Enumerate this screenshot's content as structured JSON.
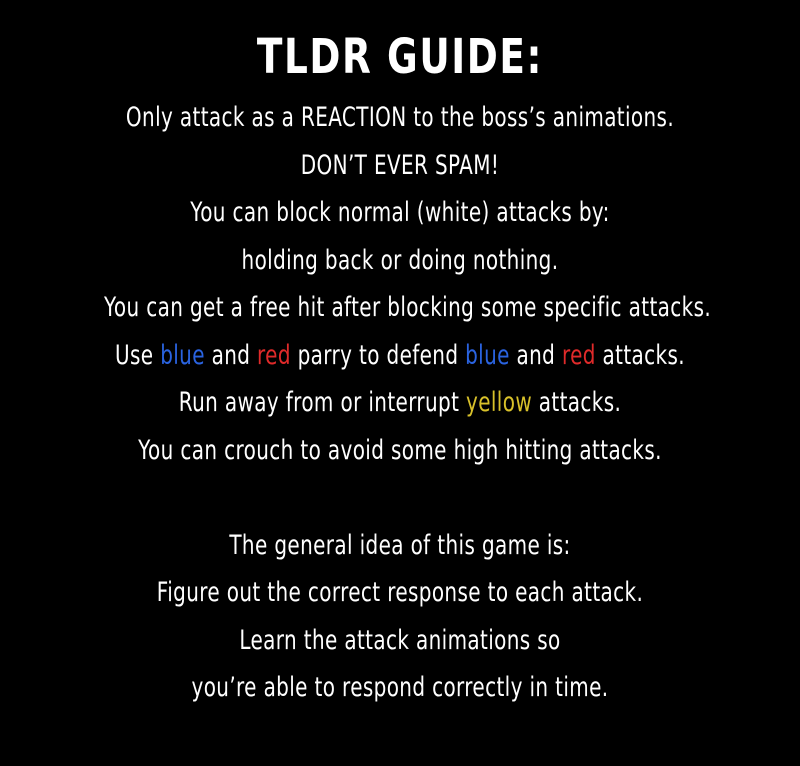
{
  "title": "TLDR GUIDE:",
  "lines": {
    "l1": "Only attack as a REACTION to the boss’s animations.",
    "l2": "DON’T EVER SPAM!",
    "l3": "You can block normal (white) attacks by:",
    "l4": "holding back or doing nothing.",
    "l5": "You can get a free hit after blocking some specific attacks.",
    "l6": {
      "p1": "Use ",
      "blue1": "blue",
      "p2": " and ",
      "red1": "red",
      "p3": " parry to defend ",
      "blue2": "blue",
      "p4": " and ",
      "red2": "red",
      "p5": " attacks."
    },
    "l7": {
      "p1": "Run away from or interrupt ",
      "yellow": "yellow",
      "p2": " attacks."
    },
    "l8": "You can crouch to avoid some high hitting attacks.",
    "l9": "The general idea of this game is:",
    "l10": "Figure out the correct response to each attack.",
    "l11": "Learn the attack animations so",
    "l12": "you’re able to respond correctly in time."
  },
  "colors": {
    "background": "#000000",
    "text": "#ffffff",
    "blue": "#2a63e0",
    "red": "#e02a2a",
    "yellow": "#d8c12a"
  }
}
